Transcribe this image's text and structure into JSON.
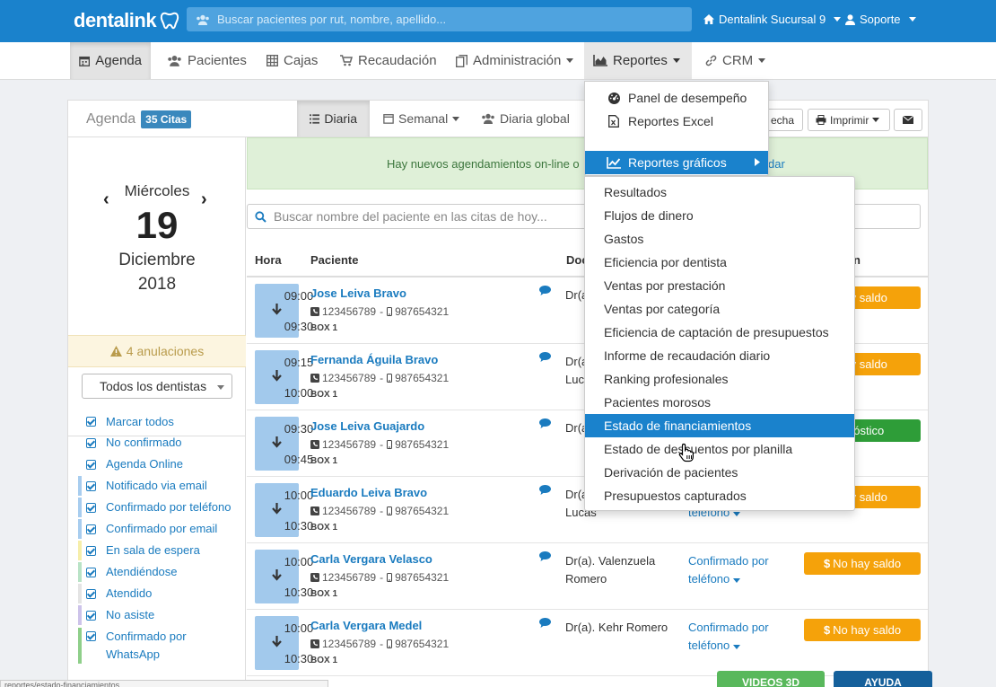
{
  "brand": {
    "name": "dentalink"
  },
  "topbar": {
    "search_placeholder": "Buscar pacientes por rut, nombre, apellido...",
    "branch": "Dentalink Sucursal 9",
    "user": "Soporte"
  },
  "nav": {
    "agenda": "Agenda",
    "pacientes": "Pacientes",
    "cajas": "Cajas",
    "recaudacion": "Recaudación",
    "administracion": "Administración",
    "reportes": "Reportes",
    "crm": "CRM"
  },
  "agenda": {
    "title": "Agenda",
    "citas_badge": "35 Citas",
    "tabs": {
      "diaria": "Diaria",
      "semanal": "Semanal",
      "global": "Diaria global"
    },
    "fecha_label": "echa",
    "imprimir_label": "Imprimir"
  },
  "date": {
    "day_name": "Miércoles",
    "day_num": "19",
    "month": "Diciembre",
    "year": "2018"
  },
  "left": {
    "anulaciones": "4 anulaciones",
    "dentist_select": "Todos los dentistas",
    "marcar_todos": "Marcar todos",
    "filters": [
      {
        "label": "No confirmado",
        "color": ""
      },
      {
        "label": "Agenda Online",
        "color": ""
      },
      {
        "label": "Notificado via email",
        "color": "#a8cdef"
      },
      {
        "label": "Confirmado por teléfono",
        "color": "#a8cdef"
      },
      {
        "label": "Confirmado por email",
        "color": "#a8cdef"
      },
      {
        "label": "En sala de espera",
        "color": "#f6eeaa"
      },
      {
        "label": "Atendiéndose",
        "color": "#b9e3c6"
      },
      {
        "label": "Atendido",
        "color": "#e4e4e4"
      },
      {
        "label": "No asiste",
        "color": "#cdc3ea"
      },
      {
        "label": "Confirmado por",
        "label2": "WhatsApp",
        "color": "#8fcf8a"
      }
    ]
  },
  "alert": {
    "text_left": "Hay nuevos agendamientos on-line o",
    "text_right": "dar"
  },
  "search_appt": {
    "placeholder": "Buscar nombre del paciente en las citas de hoy..."
  },
  "table": {
    "headers": {
      "hora": "Hora",
      "paciente": "Paciente",
      "doctor": "Doc",
      "estado_tail": "n"
    },
    "rows": [
      {
        "start": "09:00",
        "end": "09:30",
        "name": "Jose Leiva Bravo",
        "phone": "123456789",
        "mobile": "987654321",
        "box": "BOX 1",
        "doctor": "Dr(a",
        "doctor2": "",
        "conf": "",
        "conf2": "",
        "saldo": "hay saldo",
        "saldo_color": "#f5a20a"
      },
      {
        "start": "09:15",
        "end": "10:00",
        "name": "Fernanda Águila Bravo",
        "phone": "123456789",
        "mobile": "987654321",
        "box": "BOX 1",
        "doctor": "Dr(a",
        "doctor2": "Luc",
        "conf": "",
        "conf2": "",
        "saldo": "hay saldo",
        "saldo_color": "#f5a20a"
      },
      {
        "start": "09:30",
        "end": "09:45",
        "name": "Jose Leiva Guajardo",
        "phone": "123456789",
        "mobile": "987654321",
        "box": "BOX 1",
        "doctor": "Dr(a",
        "doctor2": "",
        "conf": "",
        "conf2": "",
        "saldo": "gnóstico",
        "saldo_color": "#2e9d38"
      },
      {
        "start": "10:00",
        "end": "10:30",
        "name": "Eduardo Leiva Bravo",
        "phone": "123456789",
        "mobile": "987654321",
        "box": "BOX 1",
        "doctor": "Dr(a",
        "doctor2": "Lucas",
        "conf": "",
        "conf2": "teléfono",
        "saldo": "hay saldo",
        "saldo_color": "#f5a20a"
      },
      {
        "start": "10:00",
        "end": "10:30",
        "name": "Carla Vergara Velasco",
        "phone": "123456789",
        "mobile": "987654321",
        "box": "BOX 1",
        "doctor": "Dr(a). Valenzuela",
        "doctor2": "Romero",
        "conf": "Confirmado por",
        "conf2": "teléfono",
        "saldo": "No hay saldo",
        "saldo_color": "#f5a20a"
      },
      {
        "start": "10:00",
        "end": "10:30",
        "name": "Carla Vergara Medel",
        "phone": "123456789",
        "mobile": "987654321",
        "box": "BOX 1",
        "doctor": "Dr(a). Kehr Romero",
        "doctor2": "",
        "conf": "Confirmado por",
        "conf2": "teléfono",
        "saldo": "No hay saldo",
        "saldo_color": "#f5a20a"
      }
    ]
  },
  "reportes_menu": {
    "panel": "Panel de desempeño",
    "excel": "Reportes Excel",
    "graficos": "Reportes gráficos"
  },
  "graficos_menu": [
    "Resultados",
    "Flujos de dinero",
    "Gastos",
    "Eficiencia por dentista",
    "Ventas por prestación",
    "Ventas por categoría",
    "Eficiencia de captación de presupuestos",
    "Informe de recaudación diario",
    "Ranking profesionales",
    "Pacientes morosos",
    "Estado de financiamientos",
    "Estado de descuentos por planilla",
    "Derivación de pacientes",
    "Presupuestos capturados"
  ],
  "graficos_highlight": "Estado de financiamientos",
  "bottom": {
    "videos": "VIDEOS 3D",
    "ayuda": "AYUDA",
    "status": "reportes/estado-financiamientos"
  }
}
